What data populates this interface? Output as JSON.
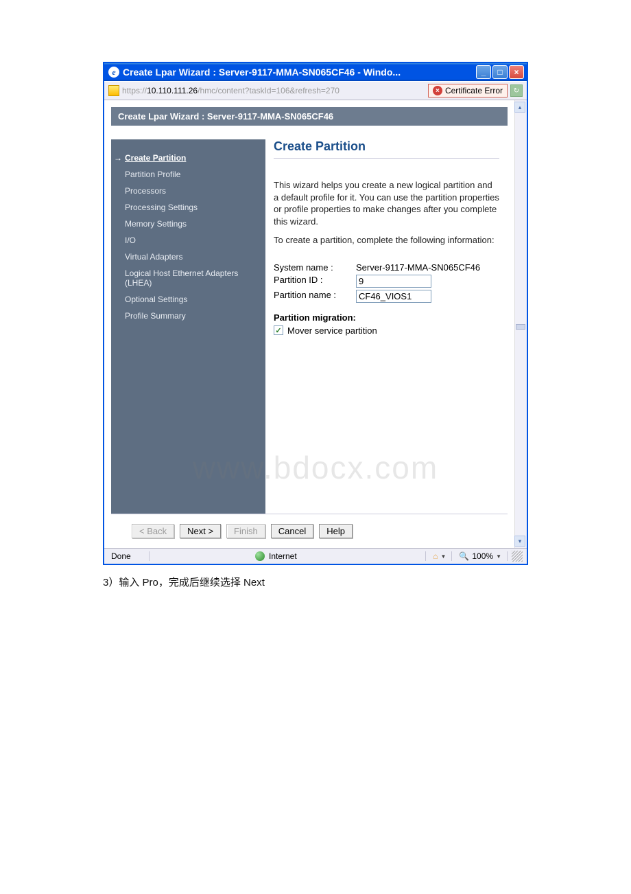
{
  "window": {
    "title": "Create Lpar Wizard : Server-9117-MMA-SN065CF46 - Windo..."
  },
  "address_bar": {
    "url_prefix": "https://",
    "url_ip": "10.110.111.26",
    "url_suffix": "/hmc/content?taskId=106&refresh=270",
    "cert_error": "Certificate Error"
  },
  "panel": {
    "header": "Create Lpar Wizard : Server-9117-MMA-SN065CF46"
  },
  "nav": {
    "items": [
      "Create Partition",
      "Partition Profile",
      "Processors",
      "Processing Settings",
      "Memory Settings",
      "I/O",
      "Virtual Adapters",
      "Logical Host Ethernet Adapters (LHEA)",
      "Optional Settings",
      "Profile Summary"
    ]
  },
  "main": {
    "title": "Create Partition",
    "desc1": "This wizard helps you create a new logical partition and a default profile for it. You can use the partition properties or profile properties to make changes after you complete this wizard.",
    "desc2": "To create a partition, complete the following information:",
    "system_name_label": "System name :",
    "system_name_value": "Server-9117-MMA-SN065CF46",
    "partition_id_label": "Partition ID :",
    "partition_id_value": "9",
    "partition_name_label": "Partition name :",
    "partition_name_value": "CF46_VIOS1",
    "migration_section": "Partition migration:",
    "mover_label": "Mover service partition"
  },
  "buttons": {
    "back": "< Back",
    "next": "Next >",
    "finish": "Finish",
    "cancel": "Cancel",
    "help": "Help"
  },
  "statusbar": {
    "done": "Done",
    "zone": "Internet",
    "zoom": "100%"
  },
  "watermark": "www.bdocx.com",
  "caption": "3）输入 Pro，完成后继续选择 Next"
}
